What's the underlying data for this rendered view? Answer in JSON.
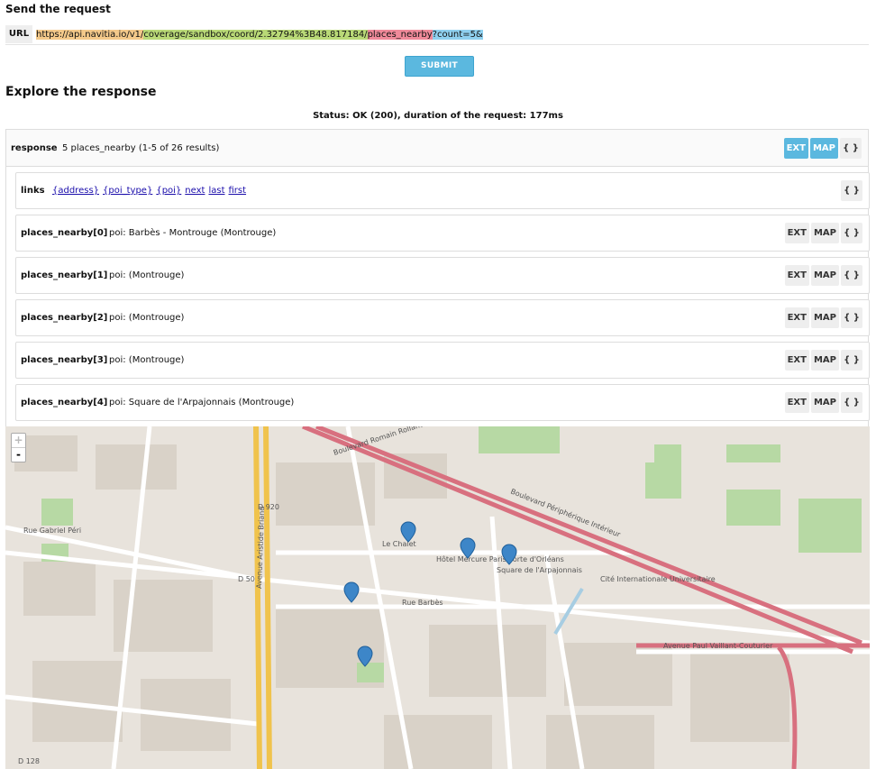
{
  "request": {
    "title": "Send the request",
    "url_label": "URL",
    "url_parts": [
      "https://api.navitia.io/v1/",
      "coverage/sandbox/coord/2.32794%3B48.817184/",
      "places_nearby",
      "?count=5&"
    ],
    "submit_label": "SUBMIT"
  },
  "response": {
    "title": "Explore the response",
    "status": "Status: OK (200), duration of the request: 177ms",
    "key": "response",
    "summary": "5 places_nearby (1-5 of 26 results)",
    "buttons": {
      "ext": "EXT",
      "map": "MAP",
      "json": "{ }"
    },
    "links_key": "links",
    "links": [
      "{address}",
      "{poi_type}",
      "{poi}",
      "next",
      "last",
      "first"
    ],
    "places": [
      {
        "key": "places_nearby[0]",
        "value": "poi: Barbès - Montrouge (Montrouge)"
      },
      {
        "key": "places_nearby[1]",
        "value": "poi: (Montrouge)"
      },
      {
        "key": "places_nearby[2]",
        "value": "poi: (Montrouge)"
      },
      {
        "key": "places_nearby[3]",
        "value": "poi: (Montrouge)"
      },
      {
        "key": "places_nearby[4]",
        "value": "poi: Square de l'Arpajonnais (Montrouge)"
      }
    ]
  },
  "map": {
    "zoom_in": "+",
    "zoom_out": "-",
    "labels": [
      "Rue Gabriel Péri",
      "Rue Barbès",
      "Avenue Paul Vaillant-Couturier",
      "Boulevard Périphérique Intérieur",
      "Avenue Aristide Briand",
      "Boulevard Romain Rolland",
      "D 920",
      "D 50",
      "D 128",
      "Cité Internationale Universitaire",
      "Square de l'Arpajonnais",
      "Le Chalet",
      "Hôtel Mercure Paris Porte d'Orléans"
    ],
    "colors": {
      "land": "#e8e3dc",
      "park": "#b7d9a4",
      "highway": "#d8707f",
      "primary": "#f0c34c",
      "water": "#a7cde2"
    }
  }
}
